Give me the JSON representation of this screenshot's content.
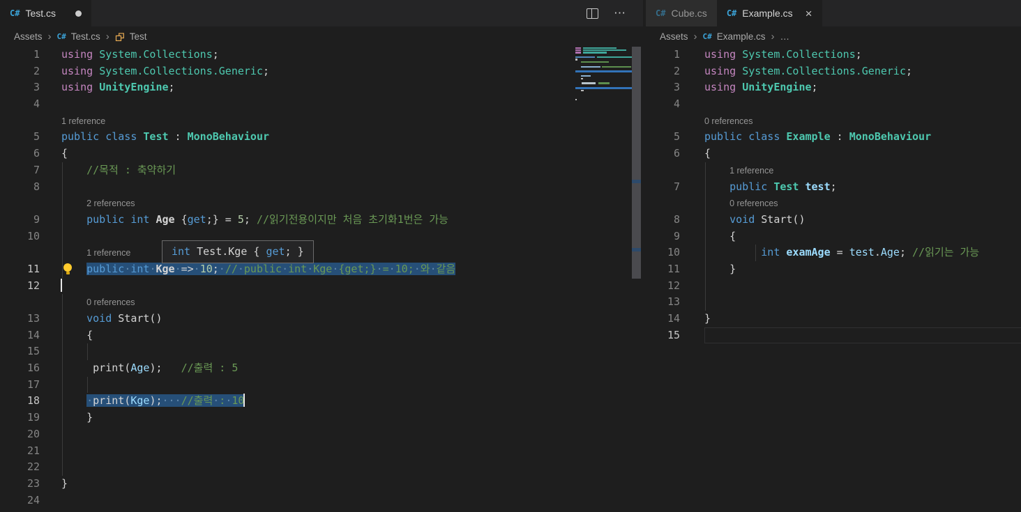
{
  "icons": {
    "csharp": "C#",
    "chevron": "›",
    "more": "⋯",
    "close": "×",
    "modified_dot": "modified",
    "split": "split-editor"
  },
  "colors": {
    "editor_bg": "#1e1e1e",
    "tabstrip_bg": "#252526",
    "inactive_tab_bg": "#2d2d2d",
    "selection": "#264F78",
    "keyword": "#569CD6",
    "using": "#C586C0",
    "type": "#4EC9B0",
    "variable": "#9CDCFE",
    "number": "#B5CEA8",
    "comment": "#6A9955",
    "text": "#D4D4D4",
    "csharp_icon": "#3ba3d8",
    "class_icon": "#e8ab53",
    "lightbulb": "#ffcb2d"
  },
  "tooltip": {
    "segments": [
      [
        "k",
        "int"
      ],
      [
        "w",
        " Test.Kge { "
      ],
      [
        "k",
        "get"
      ],
      [
        "w",
        "; }"
      ]
    ]
  },
  "left_group": {
    "tab": {
      "label": "Test.cs",
      "modified": true
    },
    "breadcrumb": [
      {
        "label": "Assets"
      },
      {
        "label": "Test.cs",
        "icon": "csharp"
      },
      {
        "label": "Test",
        "icon": "class"
      }
    ],
    "rows": [
      {
        "t": "code",
        "n": "1",
        "s": [
          [
            "u",
            "using"
          ],
          [
            "w",
            " "
          ],
          [
            "ns",
            "System.Collections"
          ],
          [
            "w",
            ";"
          ]
        ]
      },
      {
        "t": "code",
        "n": "2",
        "s": [
          [
            "u",
            "using"
          ],
          [
            "w",
            " "
          ],
          [
            "ns",
            "System.Collections.Generic"
          ],
          [
            "w",
            ";"
          ]
        ]
      },
      {
        "t": "code",
        "n": "3",
        "s": [
          [
            "u",
            "using"
          ],
          [
            "w",
            " "
          ],
          [
            "t",
            "UnityEngine"
          ],
          [
            "w",
            ";"
          ]
        ]
      },
      {
        "t": "code",
        "n": "4",
        "s": []
      },
      {
        "t": "lens",
        "text": "1 reference",
        "ind": 0
      },
      {
        "t": "code",
        "n": "5",
        "s": [
          [
            "k",
            "public"
          ],
          [
            "w",
            " "
          ],
          [
            "k",
            "class"
          ],
          [
            "w",
            " "
          ],
          [
            "t",
            "Test"
          ],
          [
            "w",
            " : "
          ],
          [
            "t",
            "MonoBehaviour"
          ]
        ]
      },
      {
        "t": "code",
        "n": "6",
        "s": [
          [
            "w",
            "{"
          ]
        ]
      },
      {
        "t": "code",
        "n": "7",
        "g": [
          0
        ],
        "s": [
          [
            "w",
            "    "
          ],
          [
            "c",
            "//목적 : 축약하기"
          ]
        ]
      },
      {
        "t": "code",
        "n": "8",
        "g": [
          0
        ],
        "s": []
      },
      {
        "t": "lens",
        "text": "2 references",
        "ind": 4,
        "g": [
          0
        ]
      },
      {
        "t": "code",
        "n": "9",
        "g": [
          0
        ],
        "s": [
          [
            "w",
            "    "
          ],
          [
            "k",
            "public"
          ],
          [
            "w",
            " "
          ],
          [
            "k",
            "int"
          ],
          [
            "w",
            " "
          ],
          [
            "d",
            "Age"
          ],
          [
            "w",
            " {"
          ],
          [
            "k",
            "get"
          ],
          [
            "w",
            ";} = "
          ],
          [
            "n",
            "5"
          ],
          [
            "w",
            "; "
          ],
          [
            "c",
            "//읽기전용이지만 처음 초기화1번은 가능"
          ]
        ]
      },
      {
        "t": "code",
        "n": "10",
        "g": [
          0
        ],
        "s": []
      },
      {
        "t": "lens",
        "text": "1 reference",
        "ind": 4,
        "g": [
          0
        ]
      },
      {
        "t": "code",
        "n": "11",
        "na": true,
        "bulb": true,
        "g": [
          0
        ],
        "s": [
          [
            "w",
            "    "
          ],
          [
            "k",
            "public",
            1
          ],
          [
            "ws",
            "·",
            1
          ],
          [
            "k",
            "int",
            1
          ],
          [
            "ws",
            "·",
            1
          ],
          [
            "d",
            "Kge",
            1
          ],
          [
            "ws",
            "·",
            1
          ],
          [
            "w",
            "=>",
            1
          ],
          [
            "ws",
            "·",
            1
          ],
          [
            "n",
            "10",
            1
          ],
          [
            "w",
            ";",
            1
          ],
          [
            "ws",
            "·",
            1
          ],
          [
            "c",
            "//",
            1
          ],
          [
            "ws",
            "·",
            1
          ],
          [
            "c",
            "public",
            1
          ],
          [
            "ws",
            "·",
            1
          ],
          [
            "c",
            "int",
            1
          ],
          [
            "ws",
            "·",
            1
          ],
          [
            "c",
            "Kge",
            1
          ],
          [
            "ws",
            "·",
            1
          ],
          [
            "c",
            "{get;}",
            1
          ],
          [
            "ws",
            "·",
            1
          ],
          [
            "c",
            "=",
            1
          ],
          [
            "ws",
            "·",
            1
          ],
          [
            "c",
            "10;",
            1
          ],
          [
            "ws",
            "·",
            1
          ],
          [
            "c",
            "와",
            1
          ],
          [
            "ws",
            "·",
            1
          ],
          [
            "c",
            "같음",
            1
          ]
        ]
      },
      {
        "t": "code",
        "n": "12",
        "na": true,
        "cur": "start",
        "s": []
      },
      {
        "t": "lens",
        "text": "0 references",
        "ind": 4,
        "g": [
          0
        ]
      },
      {
        "t": "code",
        "n": "13",
        "g": [
          0
        ],
        "s": [
          [
            "w",
            "    "
          ],
          [
            "k",
            "void"
          ],
          [
            "w",
            " Start()"
          ]
        ]
      },
      {
        "t": "code",
        "n": "14",
        "g": [
          0
        ],
        "s": [
          [
            "w",
            "    {"
          ]
        ]
      },
      {
        "t": "code",
        "n": "15",
        "g": [
          0,
          1
        ],
        "s": []
      },
      {
        "t": "code",
        "n": "16",
        "g": [
          0
        ],
        "s": [
          [
            "w",
            "     print("
          ],
          [
            "v",
            "Age"
          ],
          [
            "w",
            ");   "
          ],
          [
            "c",
            "//출력 : 5"
          ]
        ]
      },
      {
        "t": "code",
        "n": "17",
        "g": [
          0,
          1
        ],
        "s": []
      },
      {
        "t": "code",
        "n": "18",
        "na": true,
        "cur": "end",
        "g": [
          0
        ],
        "s": [
          [
            "w",
            "    "
          ],
          [
            "ws",
            "·",
            1
          ],
          [
            "w",
            "print(",
            1
          ],
          [
            "v",
            "Kge",
            1
          ],
          [
            "w",
            ");",
            1
          ],
          [
            "ws",
            "···",
            1
          ],
          [
            "c",
            "//출력",
            1
          ],
          [
            "ws",
            "·",
            1
          ],
          [
            "c",
            ":",
            1
          ],
          [
            "ws",
            "·",
            1
          ],
          [
            "c",
            "10",
            1
          ]
        ]
      },
      {
        "t": "code",
        "n": "19",
        "g": [
          0
        ],
        "s": [
          [
            "w",
            "    }"
          ]
        ]
      },
      {
        "t": "code",
        "n": "20",
        "g": [
          0
        ],
        "s": []
      },
      {
        "t": "code",
        "n": "21",
        "g": [
          0
        ],
        "s": []
      },
      {
        "t": "code",
        "n": "22",
        "g": [
          0
        ],
        "s": []
      },
      {
        "t": "code",
        "n": "23",
        "s": [
          [
            "w",
            "}"
          ]
        ]
      },
      {
        "t": "code",
        "n": "24",
        "s": []
      }
    ],
    "minimap": [
      {
        "segs": [
          [
            0,
            8,
            "#b070b0"
          ],
          [
            11,
            48,
            "#3fa79a"
          ]
        ]
      },
      {
        "segs": [
          [
            0,
            8,
            "#b070b0"
          ],
          [
            11,
            62,
            "#3fa79a"
          ]
        ]
      },
      {
        "segs": [
          [
            0,
            8,
            "#b070b0"
          ],
          [
            11,
            34,
            "#3fa79a"
          ]
        ]
      },
      {
        "segs": []
      },
      {
        "segs": [
          [
            0,
            28,
            "#4f87b8"
          ],
          [
            31,
            54,
            "#3fa79a"
          ]
        ]
      },
      {
        "segs": [
          [
            0,
            3,
            "#bbbbbb"
          ]
        ]
      },
      {
        "segs": [
          [
            8,
            40,
            "#5d8f4e"
          ]
        ]
      },
      {
        "segs": []
      },
      {
        "segs": [
          [
            8,
            28,
            "#8ab0d0"
          ],
          [
            38,
            42,
            "#5d8f4e"
          ]
        ]
      },
      {
        "segs": []
      },
      {
        "bar": true
      },
      {
        "segs": []
      },
      {
        "segs": [
          [
            8,
            14,
            "#8ab0d0"
          ]
        ]
      },
      {
        "segs": [
          [
            8,
            3,
            "#bbbbbb"
          ]
        ]
      },
      {
        "segs": []
      },
      {
        "segs": [
          [
            9,
            20,
            "#b8c4cc"
          ],
          [
            33,
            16,
            "#5d8f4e"
          ]
        ]
      },
      {
        "segs": []
      },
      {
        "bar": true
      },
      {
        "segs": [
          [
            8,
            4,
            "#bbbbbb"
          ]
        ]
      },
      {
        "segs": []
      },
      {
        "segs": []
      },
      {
        "segs": []
      },
      {
        "segs": [
          [
            0,
            2,
            "#bbbbbb"
          ]
        ]
      },
      {
        "segs": []
      }
    ]
  },
  "right_group": {
    "tabs": [
      {
        "label": "Cube.cs",
        "active": false
      },
      {
        "label": "Example.cs",
        "active": true,
        "closable": true
      }
    ],
    "breadcrumb": [
      {
        "label": "Assets"
      },
      {
        "label": "Example.cs",
        "icon": "csharp"
      },
      {
        "label": "…"
      }
    ],
    "rows": [
      {
        "t": "code",
        "n": "1",
        "s": [
          [
            "u",
            "using"
          ],
          [
            "w",
            " "
          ],
          [
            "ns",
            "System.Collections"
          ],
          [
            "w",
            ";"
          ]
        ]
      },
      {
        "t": "code",
        "n": "2",
        "s": [
          [
            "u",
            "using"
          ],
          [
            "w",
            " "
          ],
          [
            "ns",
            "System.Collections.Generic"
          ],
          [
            "w",
            ";"
          ]
        ]
      },
      {
        "t": "code",
        "n": "3",
        "s": [
          [
            "u",
            "using"
          ],
          [
            "w",
            " "
          ],
          [
            "t",
            "UnityEngine"
          ],
          [
            "w",
            ";"
          ]
        ]
      },
      {
        "t": "code",
        "n": "4",
        "s": []
      },
      {
        "t": "lens",
        "text": "0 references",
        "ind": 0
      },
      {
        "t": "code",
        "n": "5",
        "s": [
          [
            "k",
            "public"
          ],
          [
            "w",
            " "
          ],
          [
            "k",
            "class"
          ],
          [
            "w",
            " "
          ],
          [
            "t",
            "Example"
          ],
          [
            "w",
            " : "
          ],
          [
            "t",
            "MonoBehaviour"
          ]
        ]
      },
      {
        "t": "code",
        "n": "6",
        "s": [
          [
            "w",
            "{"
          ]
        ]
      },
      {
        "t": "lens",
        "text": "1 reference",
        "ind": 4,
        "g": [
          0
        ]
      },
      {
        "t": "code",
        "n": "7",
        "g": [
          0
        ],
        "s": [
          [
            "w",
            "    "
          ],
          [
            "k",
            "public"
          ],
          [
            "w",
            " "
          ],
          [
            "t",
            "Test"
          ],
          [
            "w",
            " "
          ],
          [
            "vb",
            "test"
          ],
          [
            "w",
            ";"
          ]
        ]
      },
      {
        "t": "lens",
        "text": "0 references",
        "ind": 4,
        "g": [
          0
        ]
      },
      {
        "t": "code",
        "n": "8",
        "g": [
          0
        ],
        "s": [
          [
            "w",
            "    "
          ],
          [
            "k",
            "void"
          ],
          [
            "w",
            " Start()"
          ]
        ]
      },
      {
        "t": "code",
        "n": "9",
        "g": [
          0
        ],
        "s": [
          [
            "w",
            "    {"
          ]
        ]
      },
      {
        "t": "code",
        "n": "10",
        "g": [
          0,
          2
        ],
        "s": [
          [
            "w",
            "         "
          ],
          [
            "k",
            "int"
          ],
          [
            "w",
            " "
          ],
          [
            "vb",
            "examAge"
          ],
          [
            "w",
            " = "
          ],
          [
            "v",
            "test"
          ],
          [
            "w",
            "."
          ],
          [
            "v",
            "Age"
          ],
          [
            "w",
            "; "
          ],
          [
            "c",
            "//읽기는 가능"
          ]
        ]
      },
      {
        "t": "code",
        "n": "11",
        "g": [
          0
        ],
        "s": [
          [
            "w",
            "    }"
          ]
        ]
      },
      {
        "t": "code",
        "n": "12",
        "g": [
          0
        ],
        "s": []
      },
      {
        "t": "code",
        "n": "13",
        "g": [
          0
        ],
        "s": []
      },
      {
        "t": "code",
        "n": "14",
        "s": [
          [
            "w",
            "}"
          ]
        ]
      },
      {
        "t": "code",
        "n": "15",
        "na": true,
        "cl": true,
        "s": []
      }
    ]
  }
}
